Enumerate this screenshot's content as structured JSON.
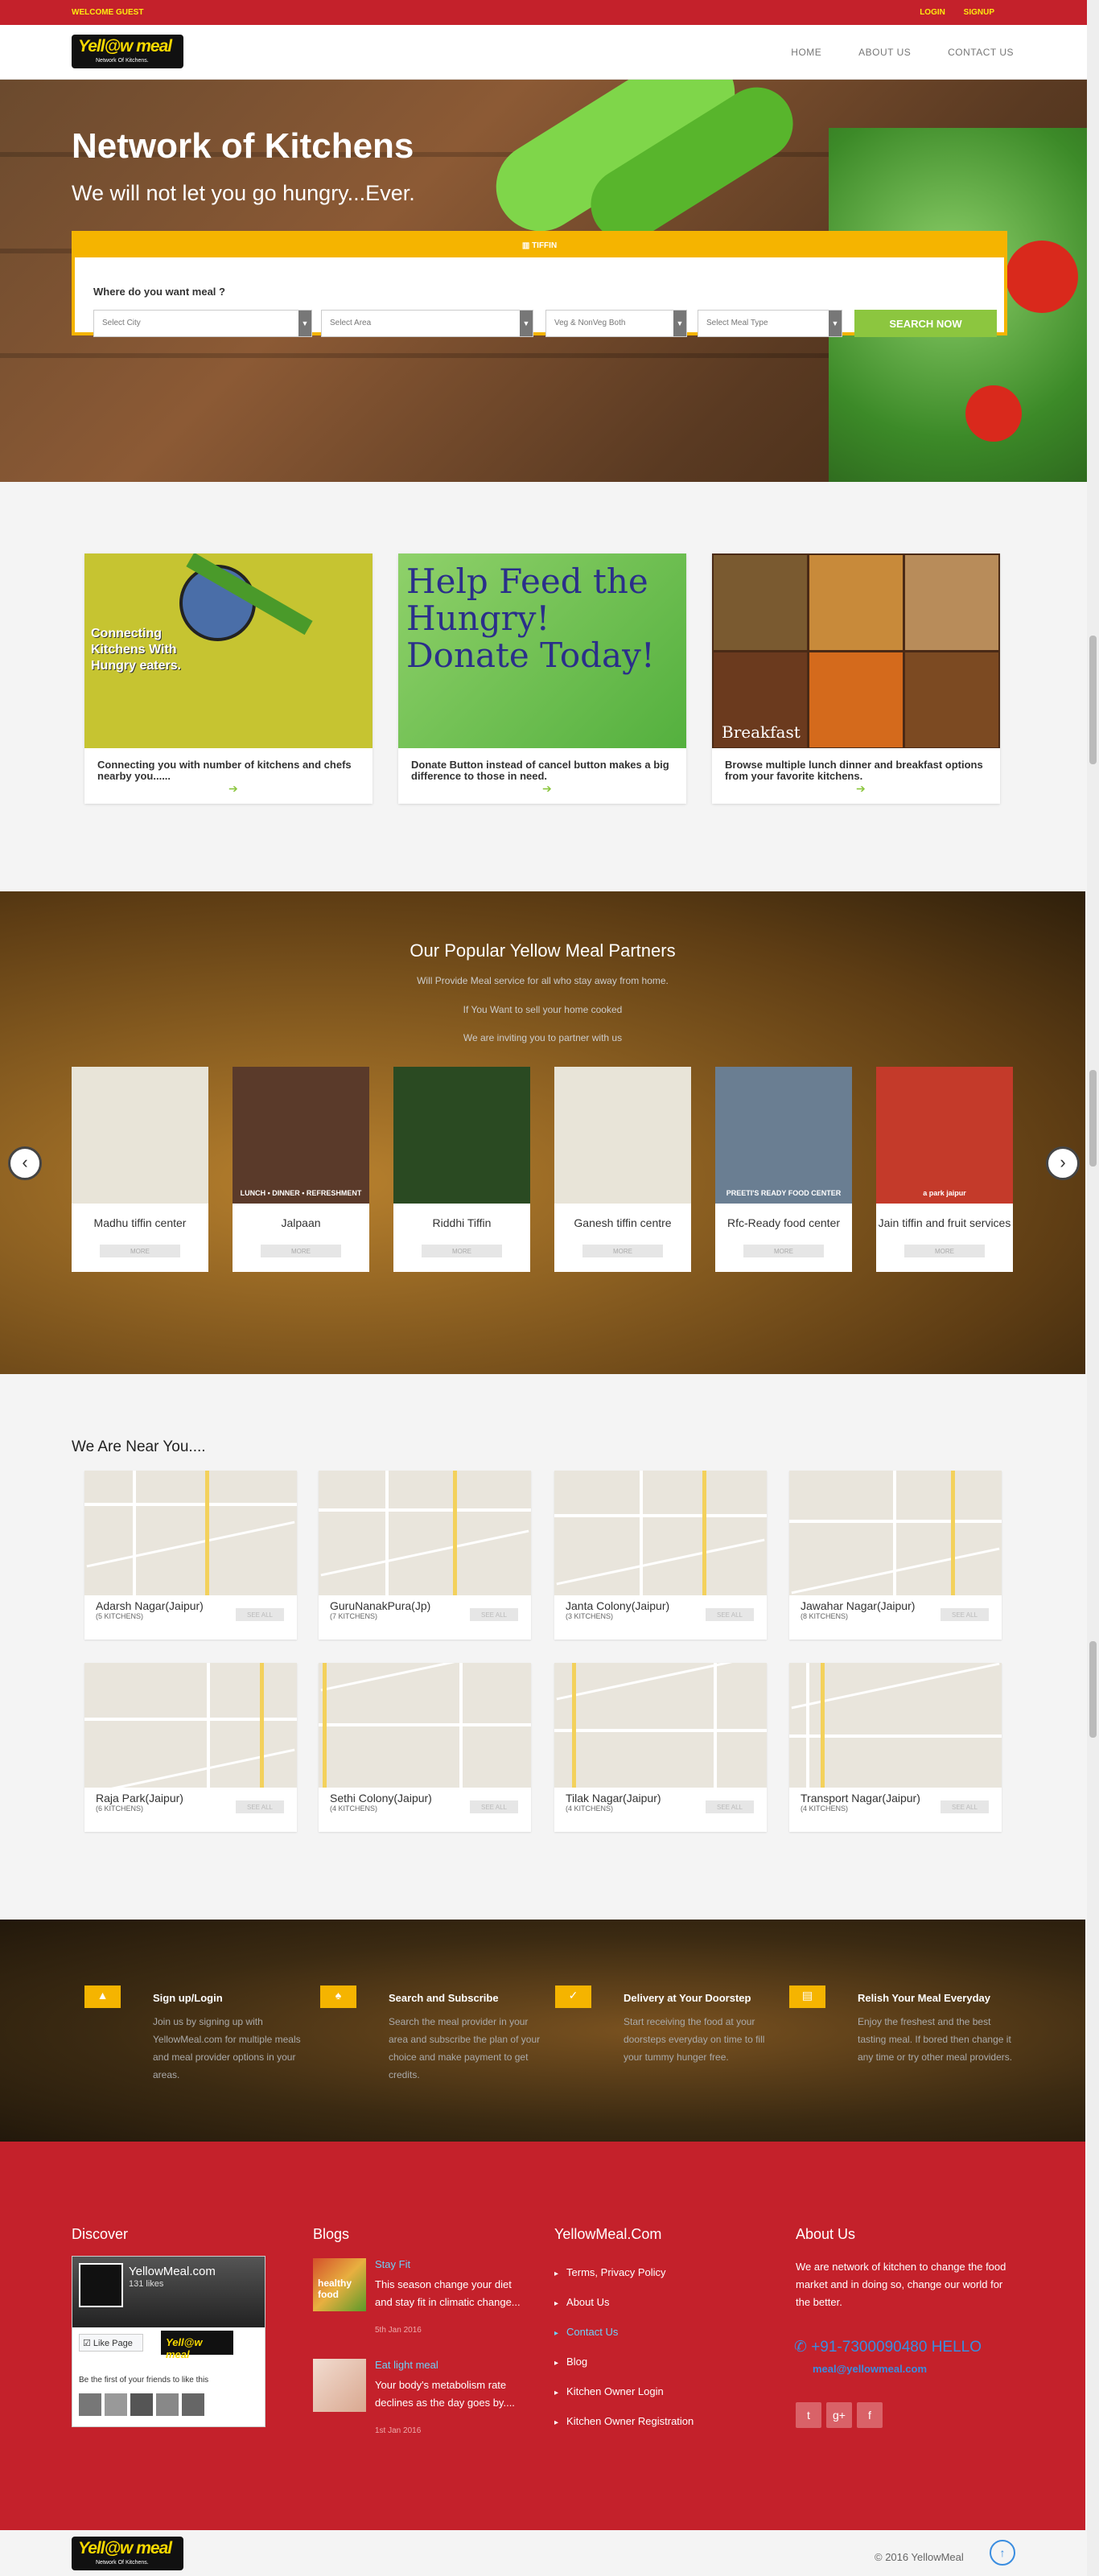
{
  "topbar": {
    "welcome": "WELCOME GUEST",
    "login": "LOGIN",
    "signup": "SIGNUP"
  },
  "brand": {
    "logo_text": "Yell@w meal",
    "tagline": "Network Of Kitchens."
  },
  "nav": {
    "home": "HOME",
    "about": "ABOUT US",
    "contact": "CONTACT US"
  },
  "hero": {
    "title": "Network of Kitchens",
    "subtitle": "We will not let you go hungry...Ever.",
    "tab": "TIFFIN",
    "question": "Where do you want meal ?",
    "select_city": "Select City",
    "select_area": "Select Area",
    "veg": "Veg & NonVeg Both",
    "meal_type": "Select Meal Type",
    "search": "SEARCH NOW"
  },
  "features": [
    {
      "text": "Connecting you with number of kitchens and chefs nearby you......",
      "img_text": "Connecting Kitchens With Hungry eaters."
    },
    {
      "text": "Donate Button instead of cancel button makes a big difference to those in need.",
      "img_text": "Help Feed the Hungry! Donate Today!"
    },
    {
      "text": "Browse multiple lunch dinner and breakfast options from your favorite kitchens.",
      "img_text": "Breakfast"
    }
  ],
  "partners": {
    "title": "Our Popular Yellow Meal Partners",
    "line1": "Will Provide Meal service for all who stay away from home.",
    "line2": "If You Want to sell your home cooked",
    "line3": "We are inviting you to partner with us",
    "more": "MORE",
    "items": [
      "Madhu tiffin center",
      "Jalpaan",
      "Riddhi Tiffin",
      "Ganesh tiffin centre",
      "Rfc-Ready food center",
      "Jain tiffin and fruit services"
    ],
    "img_labels": [
      "",
      "LUNCH • DINNER • REFRESHMENT",
      "",
      "",
      "PREETI'S READY FOOD CENTER",
      "a park jaipur"
    ]
  },
  "near": {
    "title": "We Are Near You....",
    "see_all": "SEE ALL",
    "areas": [
      {
        "name": "Adarsh Nagar(Jaipur)",
        "count": "(5 KITCHENS)"
      },
      {
        "name": "GuruNanakPura(Jp)",
        "count": "(7 KITCHENS)"
      },
      {
        "name": "Janta Colony(Jaipur)",
        "count": "(3 KITCHENS)"
      },
      {
        "name": "Jawahar Nagar(Jaipur)",
        "count": "(8 KITCHENS)"
      },
      {
        "name": "Raja Park(Jaipur)",
        "count": "(6 KITCHENS)"
      },
      {
        "name": "Sethi Colony(Jaipur)",
        "count": "(4 KITCHENS)"
      },
      {
        "name": "Tilak Nagar(Jaipur)",
        "count": "(4 KITCHENS)"
      },
      {
        "name": "Transport Nagar(Jaipur)",
        "count": "(4 KITCHENS)"
      }
    ]
  },
  "steps": [
    {
      "title": "Sign up/Login",
      "desc": "Join us by signing up with YellowMeal.com for multiple meals and meal provider options in your areas."
    },
    {
      "title": "Search and Subscribe",
      "desc": "Search the meal provider in your area and subscribe the plan of your choice and make payment to get credits."
    },
    {
      "title": "Delivery at Your Doorstep",
      "desc": "Start receiving the food at your doorsteps everyday on time to fill your tummy hunger free."
    },
    {
      "title": "Relish Your Meal Everyday",
      "desc": "Enjoy the freshest and the best tasting meal. If bored then change it any time or try other meal providers."
    }
  ],
  "footer": {
    "discover": "Discover",
    "blogs": "Blogs",
    "site": "YellowMeal.Com",
    "about_title": "About Us",
    "fb_name": "YellowMeal.com",
    "fb_likes": "131 likes",
    "fb_like_page": "Like Page",
    "fb_first": "Be the first of your friends to like this",
    "blog_items": [
      {
        "title": "Stay Fit",
        "desc": "This season change your diet and stay fit in climatic change...",
        "date": "5th Jan 2016",
        "img_text": "healthy food"
      },
      {
        "title": "Eat light meal",
        "desc": "Your body's metabolism rate declines as the day goes by....",
        "date": "1st Jan 2016",
        "img_text": ""
      }
    ],
    "links": [
      "Terms, Privacy Policy",
      "About Us",
      "Contact Us",
      "Blog",
      "Kitchen Owner Login",
      "Kitchen Owner Registration"
    ],
    "about_text": "We are network of kitchen to change the food market and in doing so, change our world for the better.",
    "phone": "+91-7300090480 HELLO",
    "email": "meal@yellowmeal.com",
    "copyright": "© 2016 YellowMeal"
  },
  "colors": {
    "brand_red": "#c4212b",
    "brand_yellow": "#f5b400",
    "search_green": "#8cc63f",
    "link_blue": "#3a8de0"
  }
}
